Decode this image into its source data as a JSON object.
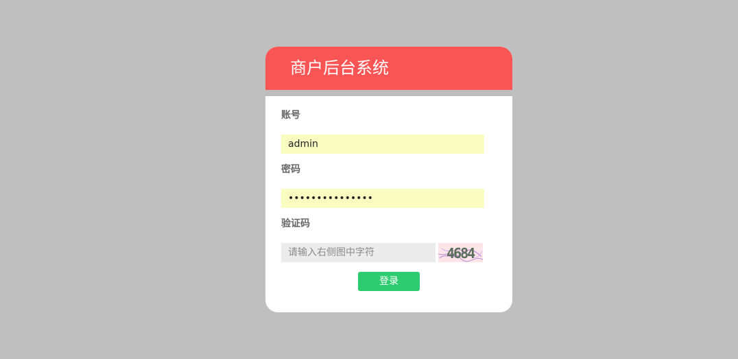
{
  "header": {
    "title": "商户后台系统"
  },
  "form": {
    "account": {
      "label": "账号",
      "value": "admin"
    },
    "password": {
      "label": "密码",
      "value": "123456789012345"
    },
    "captcha": {
      "label": "验证码",
      "placeholder": "请输入右侧图中字符",
      "image_text": "4684"
    },
    "submit_label": "登录"
  },
  "colors": {
    "page_background": "#bfbfbf",
    "header_background": "#f95555",
    "autofill_background": "#fafdc2",
    "captcha_input_background": "#ececec",
    "button_background": "#2ecc71"
  }
}
